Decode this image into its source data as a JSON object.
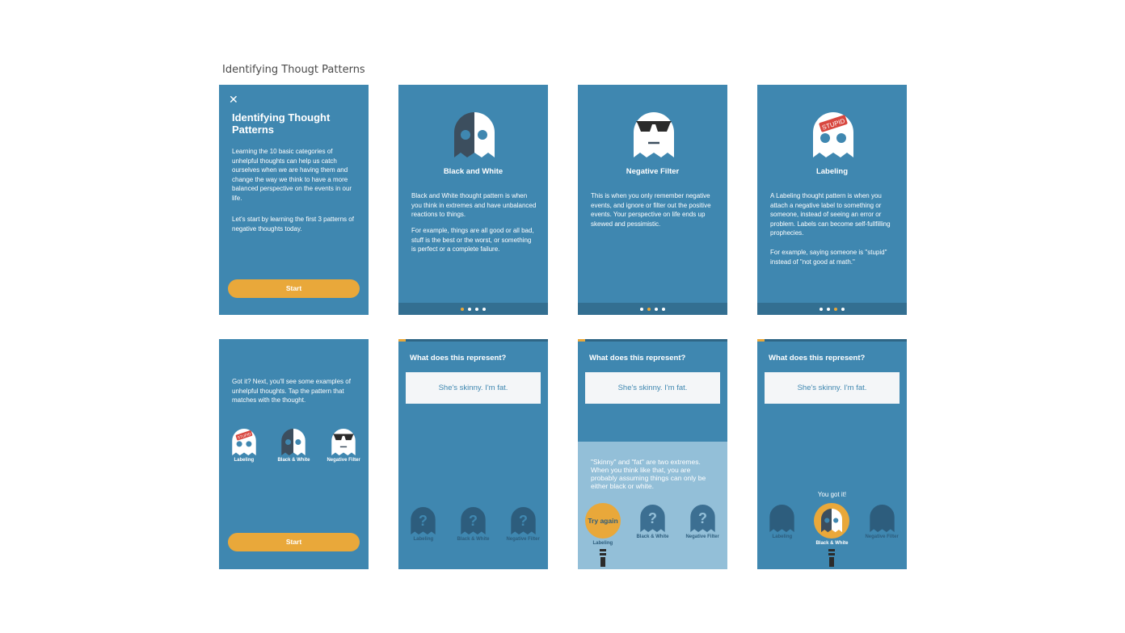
{
  "page_title": "Identifying Thougt Patterns",
  "colors": {
    "screen_bg": "#3f87b0",
    "accent": "#e9a83a",
    "ghost_dark": "#3c4e5e",
    "ghost_light": "#ffffff",
    "feedback_bg": "#93bfd8",
    "sticker": "#d8473f"
  },
  "screen1": {
    "close_icon": "✕",
    "title": "Identifying Thought Patterns",
    "para1": "Learning the 10 basic categories of unhelpful thoughts can help us catch ourselves when we are having them and change the way we think to have a more balanced perspective on the events in our life.",
    "para2": "Let's start by learning the first 3 patterns of negative thoughts today.",
    "button": "Start"
  },
  "screen2": {
    "title": "Black and White",
    "para1": "Black and White thought pattern is when you think in extremes and have unbalanced reactions to things.",
    "para2": "For example, things are all good or all bad, stuff is the best or the worst, or something is perfect or a complete failure."
  },
  "screen3": {
    "title": "Negative Filter",
    "para1": "This is when you only remember negative events, and ignore or filter out the positive events. Your perspective on life ends up skewed and pessimistic."
  },
  "screen4": {
    "title": "Labeling",
    "sticker": "STUPID",
    "para1": "A Labeling thought pattern is when you attach a negative label to something or someone, instead of seeing an error or problem. Labels can become self-fullfilling prophecies.",
    "para2": "For example, saying someone is \"stupid\" instead of \"not good at math.\""
  },
  "screen5": {
    "para1": "Got it? Next, you'll see some examples of unhelpful thoughts. Tap the pattern that matches with the thought.",
    "labels": [
      "Labeling",
      "Black & White",
      "Negative Filter"
    ],
    "sticker": "STUPID",
    "button": "Start"
  },
  "quiz": {
    "question": "What does this represent?",
    "thought": "She's skinny. I'm fat.",
    "labels": [
      "Labeling",
      "Black & White",
      "Negative Filter"
    ]
  },
  "screen7": {
    "feedback": "\"Skinny\" and \"fat\" are two extremes. When you think like that, you are probably assuming things can only be either black or white.",
    "try_again": "Try again"
  },
  "screen8": {
    "you_got_it": "You got it!"
  }
}
